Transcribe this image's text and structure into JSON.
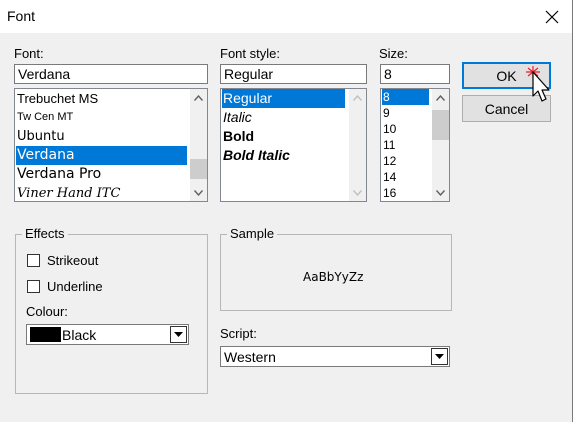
{
  "window": {
    "title": "Font"
  },
  "font": {
    "label": "Font:",
    "value": "Verdana",
    "items": [
      "Trebuchet MS",
      "Tw Cen MT",
      "Ubuntu",
      "Verdana",
      "Verdana Pro",
      "Viner Hand ITC"
    ],
    "selected": "Verdana"
  },
  "style": {
    "label": "Font style:",
    "value": "Regular",
    "items": [
      "Regular",
      "Italic",
      "Bold",
      "Bold Italic"
    ],
    "selected": "Regular"
  },
  "size": {
    "label": "Size:",
    "value": "8",
    "items": [
      "8",
      "9",
      "10",
      "11",
      "12",
      "14",
      "16"
    ],
    "selected": "8"
  },
  "buttons": {
    "ok": "OK",
    "cancel": "Cancel"
  },
  "effects": {
    "label": "Effects",
    "strikeout": "Strikeout",
    "underline": "Underline",
    "colour_label": "Colour:",
    "colour_value": "Black",
    "colour_swatch": "#000000"
  },
  "sample": {
    "label": "Sample",
    "text": "AaBbYyZz"
  },
  "script": {
    "label": "Script:",
    "value": "Western"
  },
  "colors": {
    "selection": "#0078d7",
    "window_bg": "#f0f0f0",
    "default_button_border": "#0078d7"
  },
  "icons": {
    "close": "close-icon",
    "cursor": "mouse-pointer-icon"
  }
}
